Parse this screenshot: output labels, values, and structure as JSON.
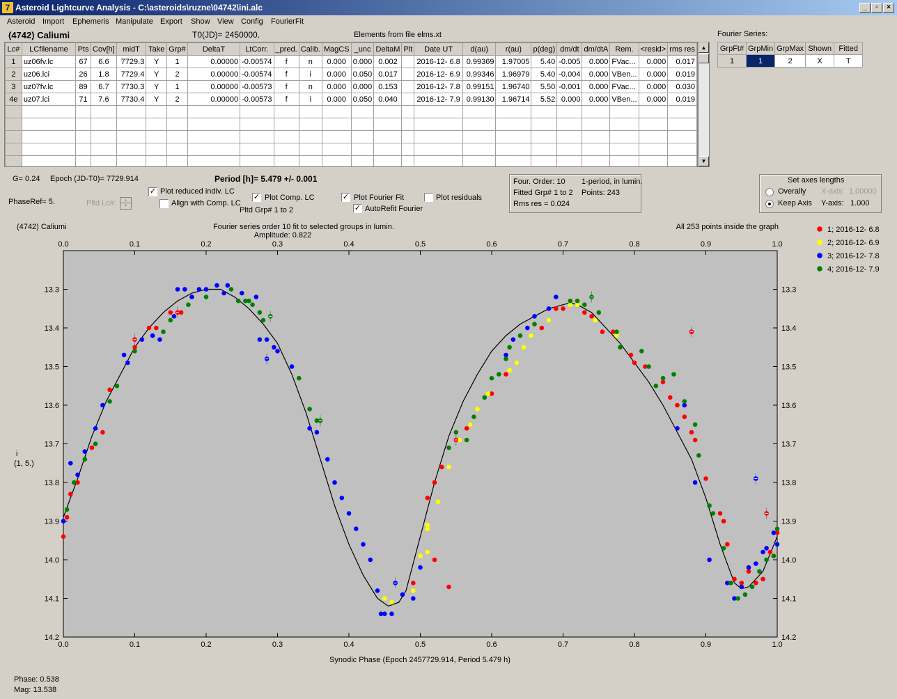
{
  "window": {
    "title": "Asteroid Lightcurve Analysis - C:\\asteroids\\ruzne\\04742\\ini.alc",
    "icon_glyph": "7",
    "min_glyph": "_",
    "max_glyph": "▫",
    "close_glyph": "×"
  },
  "menu": [
    "Asteroid",
    "Import",
    "Ephemeris",
    "Manipulate",
    "Export",
    "Show",
    "View",
    "Config",
    "FourierFit"
  ],
  "header": {
    "asteroid": "(4742) Caliumi",
    "t0": "T0(JD)= 2450000.",
    "elements": "Elements from file elms.xt"
  },
  "table": {
    "columns": [
      "Lc#",
      "LCfilename",
      "Pts",
      "Cov[h]",
      "midT",
      "Take",
      "Grp#",
      "DeltaT",
      "LtCorr.",
      "_pred.",
      "Calib.",
      "MagCS",
      "_unc",
      "DeltaM",
      "Plt",
      "Date UT",
      "d(au)",
      "r(au)",
      "p(deg)",
      "dm/dt",
      "dm/dtA",
      "Rem.",
      "<resid>",
      "rms res"
    ],
    "rows": [
      [
        "1",
        "uz06fv.lc",
        "67",
        "6.6",
        "7729.3",
        "Y",
        "1",
        "0.00000",
        "-0.00574",
        "f",
        "n",
        "0.000",
        "0.000",
        "0.002",
        "",
        "2016-12- 6.8",
        "0.99369",
        "1.97005",
        "5.40",
        "-0.005",
        "0.000",
        "FVac...",
        "0.000",
        "0.017"
      ],
      [
        "2",
        "uz06.lci",
        "26",
        "1.8",
        "7729.4",
        "Y",
        "2",
        "0.00000",
        "-0.00574",
        "f",
        "i",
        "0.000",
        "0.050",
        "0.017",
        "",
        "2016-12- 6.9",
        "0.99346",
        "1.96979",
        "5.40",
        "-0.004",
        "0.000",
        "VBen...",
        "0.000",
        "0.019"
      ],
      [
        "3",
        "uz07fv.lc",
        "89",
        "6.7",
        "7730.3",
        "Y",
        "1",
        "0.00000",
        "-0.00573",
        "f",
        "n",
        "0.000",
        "0.000",
        "0.153",
        "",
        "2016-12- 7.8",
        "0.99151",
        "1.96740",
        "5.50",
        "-0.001",
        "0.000",
        "FVac...",
        "0.000",
        "0.030"
      ],
      [
        "4e",
        "uz07.lci",
        "71",
        "7.6",
        "7730.4",
        "Y",
        "2",
        "0.00000",
        "-0.00573",
        "f",
        "i",
        "0.000",
        "0.050",
        "0.040",
        "",
        "2016-12- 7.9",
        "0.99130",
        "1.96714",
        "5.52",
        "0.000",
        "0.000",
        "VBen...",
        "0.000",
        "0.019"
      ]
    ],
    "empty_rows": 6
  },
  "fourier": {
    "title": "Fourier Series:",
    "columns": [
      "GrpFt#",
      "GrpMin",
      "GrpMax",
      "Shown",
      "Fitted"
    ],
    "row": [
      "1",
      "1",
      "2",
      "X",
      "T"
    ]
  },
  "controls": {
    "g": "G= 0.24",
    "epoch": "Epoch (JD-T0)= 7729.914",
    "period": "Period [h]= 5.479 +/- 0.001",
    "phase_ref": "PhaseRef= 5.",
    "pltd_lc": "Pltd Lc#:",
    "plot_reduced": "Plot reduced indiv. LC",
    "align": "Align with Comp. LC",
    "plot_comp": "Plot Comp. LC",
    "pltd_grp": "Pltd Grp#  1   to   2",
    "plot_fourier": "Plot Fourier Fit",
    "autorefit": "AutoRefit Fourier",
    "plot_residuals": "Plot residuals",
    "four_order": "Four. Order: 10",
    "one_period": "1-period, in lumin.",
    "fitted_grp": "Fitted Grp# 1 to 2",
    "points": "Points: 243",
    "rms_res": "Rms res     = 0.024",
    "axes_title": "Set axes lengths",
    "overally": "Overally",
    "keep_axis": "Keep Axis",
    "x_axis_label": "X-axis:",
    "x_axis_value": "1.00000",
    "y_axis_label": "Y-axis:",
    "y_axis_value": "1.000",
    "checks": {
      "plot_reduced": true,
      "align": false,
      "plot_comp": true,
      "plot_fourier": true,
      "autorefit": true,
      "plot_residuals": false
    },
    "check_glyph": "✓",
    "spin_up": "▲",
    "spin_down": "▼"
  },
  "footer": {
    "phase": "Phase:  0.538",
    "mag": "Mag:    13.538"
  },
  "chart_data": {
    "type": "scatter",
    "title": "Fourier series order 10 fit to selected groups in lumin.",
    "subtitle": "Amplitude: 0.822",
    "left_label": "(4742) Caliumi",
    "right_label": "All 253 points inside the graph",
    "xlabel": "Synodic Phase (Epoch 2457729.914, Period 5.479 h)",
    "ylabel": [
      "i",
      "(1, 5.)"
    ],
    "xlim": [
      0,
      1
    ],
    "ylim": [
      14.2,
      13.2
    ],
    "xticks": [
      "0.0",
      "0.1",
      "0.2",
      "0.3",
      "0.4",
      "0.5",
      "0.6",
      "0.7",
      "0.8",
      "0.9",
      "1.0"
    ],
    "yticks": [
      "13.3",
      "13.4",
      "13.5",
      "13.6",
      "13.7",
      "13.8",
      "13.9",
      "14.0",
      "14.1",
      "14.2"
    ],
    "background": "#c0c0c0",
    "fit_curve": {
      "x": [
        0.0,
        0.02,
        0.04,
        0.06,
        0.08,
        0.1,
        0.12,
        0.14,
        0.16,
        0.18,
        0.2,
        0.22,
        0.24,
        0.26,
        0.28,
        0.3,
        0.32,
        0.34,
        0.36,
        0.38,
        0.4,
        0.42,
        0.44,
        0.455,
        0.47,
        0.48,
        0.5,
        0.52,
        0.54,
        0.56,
        0.58,
        0.6,
        0.62,
        0.64,
        0.66,
        0.68,
        0.7,
        0.71,
        0.72,
        0.74,
        0.76,
        0.78,
        0.8,
        0.82,
        0.84,
        0.86,
        0.88,
        0.9,
        0.92,
        0.94,
        0.95,
        0.96,
        0.98,
        1.0
      ],
      "y": [
        13.89,
        13.79,
        13.68,
        13.59,
        13.52,
        13.45,
        13.4,
        13.36,
        13.33,
        13.31,
        13.3,
        13.3,
        13.32,
        13.35,
        13.39,
        13.44,
        13.52,
        13.62,
        13.74,
        13.86,
        13.96,
        14.04,
        14.1,
        14.12,
        14.11,
        14.08,
        13.94,
        13.8,
        13.68,
        13.59,
        13.52,
        13.46,
        13.42,
        13.39,
        13.37,
        13.35,
        13.34,
        13.335,
        13.34,
        13.36,
        13.4,
        13.44,
        13.49,
        13.54,
        13.6,
        13.67,
        13.74,
        13.84,
        13.96,
        14.06,
        14.075,
        14.07,
        14.03,
        13.94
      ]
    },
    "series": [
      {
        "name": "1; 2016-12- 6.8",
        "color": "#ff0000",
        "points": [
          [
            0.0,
            13.94
          ],
          [
            0.005,
            13.89
          ],
          [
            0.01,
            13.83
          ],
          [
            0.02,
            13.8
          ],
          [
            0.03,
            13.74
          ],
          [
            0.04,
            13.71
          ],
          [
            0.055,
            13.67
          ],
          [
            0.065,
            13.56
          ],
          [
            0.1,
            13.45
          ],
          [
            0.12,
            13.4
          ],
          [
            0.13,
            13.4
          ],
          [
            0.15,
            13.36
          ],
          [
            0.165,
            13.36
          ],
          [
            0.51,
            13.84
          ],
          [
            0.52,
            13.8
          ],
          [
            0.53,
            13.76
          ],
          [
            0.565,
            13.66
          ],
          [
            0.57,
            13.65
          ],
          [
            0.6,
            13.57
          ],
          [
            0.62,
            13.52
          ],
          [
            0.67,
            13.4
          ],
          [
            0.69,
            13.35
          ],
          [
            0.7,
            13.35
          ],
          [
            0.73,
            13.36
          ],
          [
            0.74,
            13.37
          ],
          [
            0.755,
            13.41
          ],
          [
            0.77,
            13.41
          ],
          [
            0.795,
            13.47
          ],
          [
            0.8,
            13.49
          ],
          [
            0.815,
            13.5
          ],
          [
            0.84,
            13.54
          ],
          [
            0.85,
            13.58
          ],
          [
            0.86,
            13.6
          ],
          [
            0.87,
            13.63
          ],
          [
            0.88,
            13.67
          ],
          [
            0.885,
            13.69
          ],
          [
            0.9,
            13.79
          ],
          [
            0.92,
            13.88
          ],
          [
            0.925,
            13.9
          ],
          [
            0.93,
            13.96
          ],
          [
            0.94,
            14.05
          ],
          [
            0.95,
            14.06
          ],
          [
            0.96,
            14.03
          ],
          [
            0.97,
            14.06
          ],
          [
            0.98,
            14.05
          ],
          [
            0.99,
            13.98
          ],
          [
            1.0,
            13.93
          ],
          [
            0.54,
            14.07
          ],
          [
            0.52,
            14.0
          ],
          [
            0.49,
            14.06
          ]
        ]
      },
      {
        "name": "2; 2016-12- 6.9",
        "color": "#ffff00",
        "points": [
          [
            0.51,
            13.92
          ],
          [
            0.525,
            13.85
          ],
          [
            0.54,
            13.76
          ],
          [
            0.555,
            13.69
          ],
          [
            0.57,
            13.65
          ],
          [
            0.58,
            13.61
          ],
          [
            0.595,
            13.57
          ],
          [
            0.625,
            13.51
          ],
          [
            0.635,
            13.49
          ],
          [
            0.645,
            13.45
          ],
          [
            0.655,
            13.42
          ],
          [
            0.68,
            13.38
          ],
          [
            0.71,
            13.34
          ],
          [
            0.72,
            13.34
          ],
          [
            0.745,
            13.38
          ],
          [
            0.775,
            13.42
          ],
          [
            0.51,
            13.91
          ],
          [
            0.5,
            13.99
          ],
          [
            0.49,
            14.08
          ],
          [
            0.46,
            14.11
          ],
          [
            0.45,
            14.1
          ],
          [
            0.51,
            13.98
          ]
        ]
      },
      {
        "name": "3; 2016-12- 7.8",
        "color": "#0000ff",
        "points": [
          [
            0.0,
            13.9
          ],
          [
            0.01,
            13.75
          ],
          [
            0.02,
            13.78
          ],
          [
            0.03,
            13.72
          ],
          [
            0.045,
            13.66
          ],
          [
            0.055,
            13.6
          ],
          [
            0.085,
            13.47
          ],
          [
            0.09,
            13.49
          ],
          [
            0.11,
            13.43
          ],
          [
            0.125,
            13.42
          ],
          [
            0.135,
            13.43
          ],
          [
            0.155,
            13.37
          ],
          [
            0.16,
            13.3
          ],
          [
            0.17,
            13.3
          ],
          [
            0.18,
            13.32
          ],
          [
            0.19,
            13.3
          ],
          [
            0.2,
            13.3
          ],
          [
            0.215,
            13.29
          ],
          [
            0.225,
            13.31
          ],
          [
            0.23,
            13.29
          ],
          [
            0.25,
            13.31
          ],
          [
            0.27,
            13.32
          ],
          [
            0.275,
            13.43
          ],
          [
            0.285,
            13.43
          ],
          [
            0.295,
            13.45
          ],
          [
            0.3,
            13.46
          ],
          [
            0.32,
            13.5
          ],
          [
            0.345,
            13.66
          ],
          [
            0.355,
            13.67
          ],
          [
            0.37,
            13.74
          ],
          [
            0.38,
            13.8
          ],
          [
            0.39,
            13.84
          ],
          [
            0.4,
            13.88
          ],
          [
            0.41,
            13.92
          ],
          [
            0.42,
            13.96
          ],
          [
            0.43,
            14.0
          ],
          [
            0.44,
            14.08
          ],
          [
            0.445,
            14.14
          ],
          [
            0.45,
            14.14
          ],
          [
            0.46,
            14.14
          ],
          [
            0.475,
            14.09
          ],
          [
            0.49,
            14.1
          ],
          [
            0.5,
            14.02
          ],
          [
            0.62,
            13.47
          ],
          [
            0.63,
            13.43
          ],
          [
            0.65,
            13.4
          ],
          [
            0.66,
            13.37
          ],
          [
            0.68,
            13.35
          ],
          [
            0.69,
            13.32
          ],
          [
            0.86,
            13.66
          ],
          [
            0.87,
            13.6
          ],
          [
            0.885,
            13.8
          ],
          [
            0.905,
            14.0
          ],
          [
            0.93,
            14.06
          ],
          [
            0.94,
            14.1
          ],
          [
            0.95,
            14.07
          ],
          [
            0.96,
            14.02
          ],
          [
            0.97,
            14.01
          ],
          [
            0.98,
            13.98
          ],
          [
            0.985,
            13.97
          ],
          [
            0.995,
            13.93
          ],
          [
            1.0,
            13.96
          ]
        ]
      },
      {
        "name": "4; 2016-12- 7.9",
        "color": "#008000",
        "points": [
          [
            0.005,
            13.87
          ],
          [
            0.015,
            13.8
          ],
          [
            0.03,
            13.74
          ],
          [
            0.045,
            13.7
          ],
          [
            0.065,
            13.59
          ],
          [
            0.075,
            13.55
          ],
          [
            0.1,
            13.46
          ],
          [
            0.14,
            13.41
          ],
          [
            0.15,
            13.38
          ],
          [
            0.175,
            13.34
          ],
          [
            0.2,
            13.32
          ],
          [
            0.235,
            13.3
          ],
          [
            0.245,
            13.33
          ],
          [
            0.255,
            13.33
          ],
          [
            0.26,
            13.33
          ],
          [
            0.265,
            13.34
          ],
          [
            0.275,
            13.36
          ],
          [
            0.28,
            13.38
          ],
          [
            0.33,
            13.53
          ],
          [
            0.345,
            13.61
          ],
          [
            0.355,
            13.64
          ],
          [
            0.54,
            13.71
          ],
          [
            0.55,
            13.67
          ],
          [
            0.565,
            13.69
          ],
          [
            0.575,
            13.63
          ],
          [
            0.59,
            13.58
          ],
          [
            0.6,
            13.53
          ],
          [
            0.61,
            13.52
          ],
          [
            0.62,
            13.48
          ],
          [
            0.625,
            13.45
          ],
          [
            0.64,
            13.42
          ],
          [
            0.66,
            13.39
          ],
          [
            0.71,
            13.33
          ],
          [
            0.72,
            13.33
          ],
          [
            0.73,
            13.34
          ],
          [
            0.75,
            13.36
          ],
          [
            0.775,
            13.41
          ],
          [
            0.78,
            13.45
          ],
          [
            0.81,
            13.46
          ],
          [
            0.82,
            13.5
          ],
          [
            0.83,
            13.55
          ],
          [
            0.84,
            13.53
          ],
          [
            0.855,
            13.52
          ],
          [
            0.87,
            13.59
          ],
          [
            0.885,
            13.65
          ],
          [
            0.89,
            13.73
          ],
          [
            0.905,
            13.86
          ],
          [
            0.91,
            13.88
          ],
          [
            0.925,
            13.97
          ],
          [
            0.935,
            14.06
          ],
          [
            0.945,
            14.1
          ],
          [
            0.955,
            14.09
          ],
          [
            0.965,
            14.07
          ],
          [
            0.975,
            14.03
          ],
          [
            0.985,
            14.0
          ],
          [
            0.995,
            13.99
          ],
          [
            1.0,
            13.92
          ]
        ]
      }
    ],
    "marked_points": [
      {
        "x": 0.1,
        "y": 13.43,
        "color": "#ff0000"
      },
      {
        "x": 0.16,
        "y": 13.36,
        "color": "#ff0000"
      },
      {
        "x": 0.285,
        "y": 13.48,
        "color": "#0000ff"
      },
      {
        "x": 0.29,
        "y": 13.37,
        "color": "#008000"
      },
      {
        "x": 0.36,
        "y": 13.64,
        "color": "#008000"
      },
      {
        "x": 0.55,
        "y": 13.69,
        "color": "#ff0000"
      },
      {
        "x": 0.465,
        "y": 14.06,
        "color": "#0000ff"
      },
      {
        "x": 0.74,
        "y": 13.32,
        "color": "#008000"
      },
      {
        "x": 0.88,
        "y": 13.41,
        "color": "#ff0000"
      },
      {
        "x": 0.97,
        "y": 13.79,
        "color": "#0000ff"
      },
      {
        "x": 0.985,
        "y": 13.88,
        "color": "#ff0000"
      }
    ],
    "legend_position": "right"
  }
}
